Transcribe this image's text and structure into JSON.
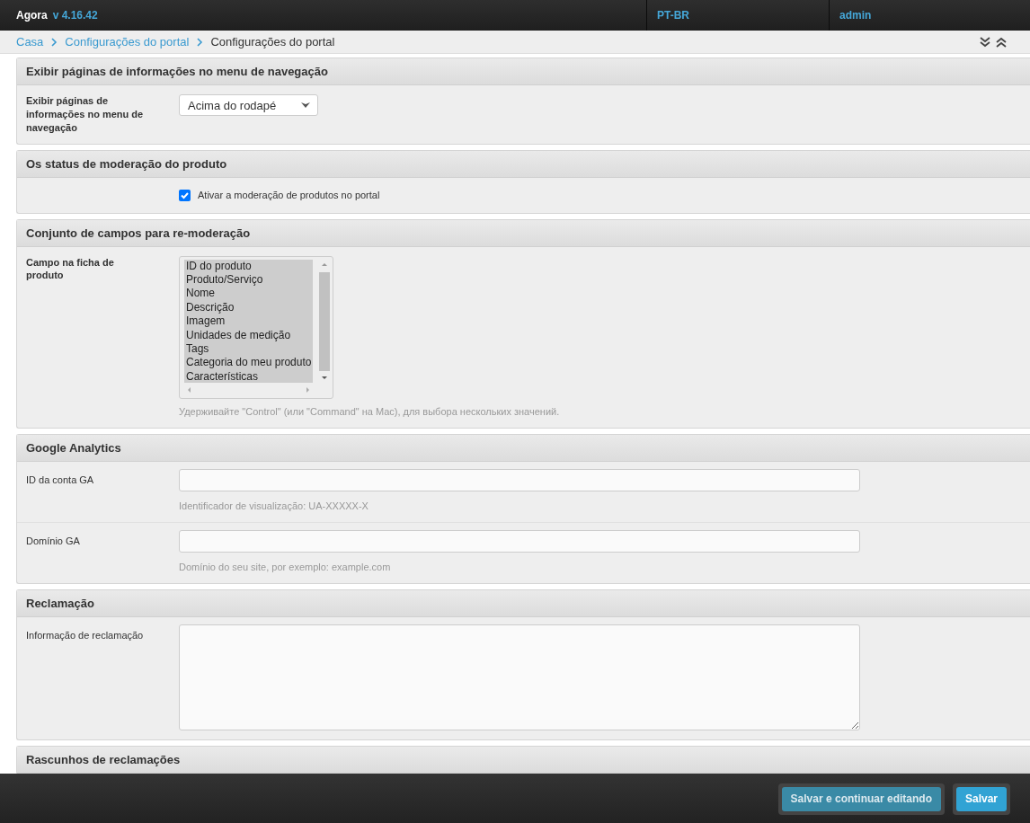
{
  "topbar": {
    "brand": "Agora",
    "version": "v 4.16.42",
    "language": "PT-BR",
    "user": "admin"
  },
  "breadcrumb": [
    {
      "label": "Casa",
      "link": true
    },
    {
      "label": "Configurações do portal",
      "link": true
    },
    {
      "label": "Configurações do portal",
      "link": false
    }
  ],
  "sections": [
    {
      "title": "Exibir páginas de informações no menu de navegação",
      "rows": [
        {
          "kind": "select",
          "label": "Exibir páginas de informações no menu de navegação",
          "value": "Acima do rodapé"
        }
      ]
    },
    {
      "title": "Os status de moderação do produto",
      "rows": [
        {
          "kind": "checkbox",
          "label": "Ativar a moderação de produtos no portal",
          "checked": true
        }
      ]
    },
    {
      "title": "Conjunto de campos para re-moderação",
      "rows": [
        {
          "kind": "multiselect",
          "label": "Campo na ficha de produto",
          "options": [
            {
              "label": "ID do produto",
              "selected": true
            },
            {
              "label": "Produto/Serviço",
              "selected": true
            },
            {
              "label": "Nome",
              "selected": true
            },
            {
              "label": "Descrição",
              "selected": true
            },
            {
              "label": "Imagem",
              "selected": true
            },
            {
              "label": "Unidades de medição",
              "selected": true
            },
            {
              "label": "Tags",
              "selected": true
            },
            {
              "label": "Categoria do meu produto",
              "selected": true
            },
            {
              "label": "Características",
              "selected": true
            }
          ],
          "help": "Удерживайте \"Control\" (или \"Command\" на Mac), для выбора нескольких значений."
        }
      ]
    },
    {
      "title": "Google Analytics",
      "rows": [
        {
          "kind": "text",
          "label": "ID da conta GA",
          "help": "Identificador de visualização: UA-XXXXX-X"
        },
        {
          "kind": "text",
          "label": "Domínio GA",
          "help": "Domínio do seu site, por exemplo: example.com"
        }
      ]
    },
    {
      "title": "Reclamação",
      "rows": [
        {
          "kind": "textarea",
          "label": "Informação de reclamação"
        }
      ]
    },
    {
      "title": "Rascunhos de reclamações"
    }
  ],
  "footer": {
    "buttons": [
      {
        "label": "Salvar e continuar editando",
        "primary": false
      },
      {
        "label": "Salvar",
        "primary": true
      }
    ]
  }
}
